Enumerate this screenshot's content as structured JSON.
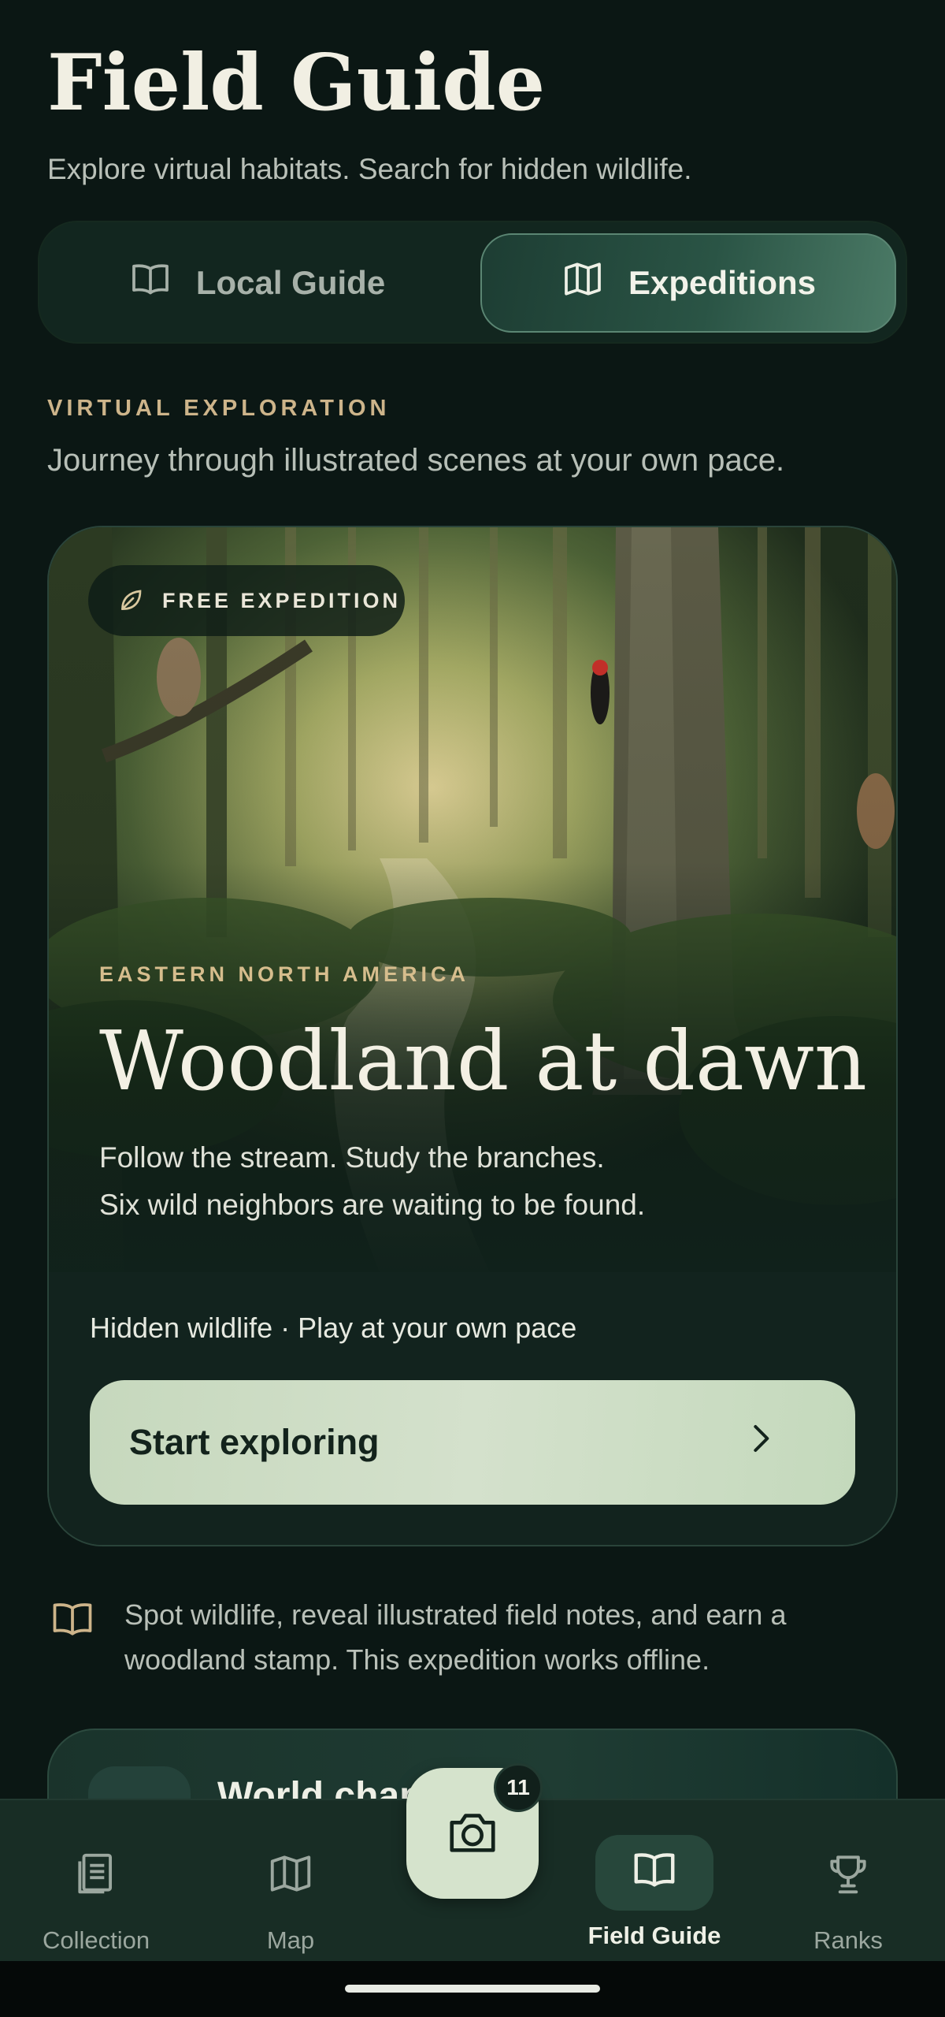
{
  "header": {
    "title": "Field Guide",
    "subtitle": "Explore virtual habitats. Search for hidden wildlife."
  },
  "tabs": [
    {
      "label": "Local Guide",
      "icon": "book-icon",
      "selected": false
    },
    {
      "label": "Expeditions",
      "icon": "map-icon",
      "selected": true
    }
  ],
  "section": {
    "eyebrow": "VIRTUAL EXPLORATION",
    "description": "Journey through illustrated scenes at your own pace."
  },
  "expedition": {
    "badge": "FREE EXPEDITION",
    "badge_icon": "leaf-icon",
    "region": "EASTERN NORTH AMERICA",
    "title": "Woodland at dawn",
    "description_line1": "Follow the stream. Study the branches.",
    "description_line2": "Six wild neighbors are waiting to be found.",
    "meta": "Hidden wildlife · Play at your own pace",
    "cta_label": "Start exploring"
  },
  "note": {
    "icon": "book-icon",
    "text": "Spot wildlife, reveal illustrated field notes, and earn a woodland stamp. This expedition works offline."
  },
  "next_card": {
    "title": "World chapt"
  },
  "nav": {
    "items": [
      {
        "label": "Collection",
        "icon": "collection-icon"
      },
      {
        "label": "Map",
        "icon": "map-icon"
      },
      {
        "label": "Field Guide",
        "icon": "book-icon",
        "active": true
      },
      {
        "label": "Ranks",
        "icon": "trophy-icon"
      }
    ],
    "camera_icon": "camera-icon",
    "camera_count": "11"
  },
  "colors": {
    "background": "#0b1714",
    "accent_gold": "#cdb48a",
    "cta": "#cfdec6"
  }
}
